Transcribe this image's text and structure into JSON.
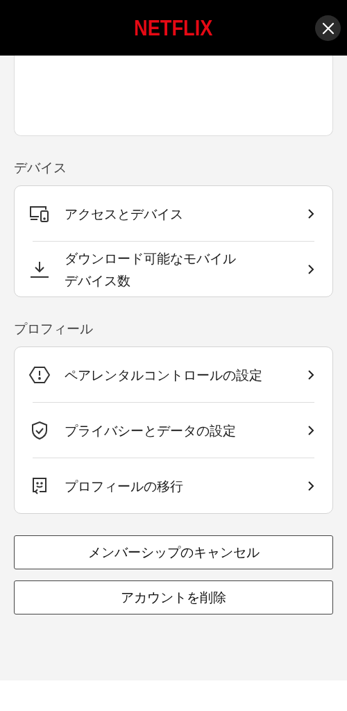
{
  "header": {
    "logo": "NETFLIX"
  },
  "sections": [
    {
      "title": "デバイス",
      "items": [
        {
          "label": "アクセスとデバイス"
        },
        {
          "label": "ダウンロード可能なモバイルデバイス数"
        }
      ]
    },
    {
      "title": "プロフィール",
      "items": [
        {
          "label": "ペアレンタルコントロールの設定"
        },
        {
          "label": "プライバシーとデータの設定"
        },
        {
          "label": "プロフィールの移行"
        }
      ]
    }
  ],
  "buttons": [
    "メンバーシップのキャンセル",
    "アカウントを削除"
  ]
}
